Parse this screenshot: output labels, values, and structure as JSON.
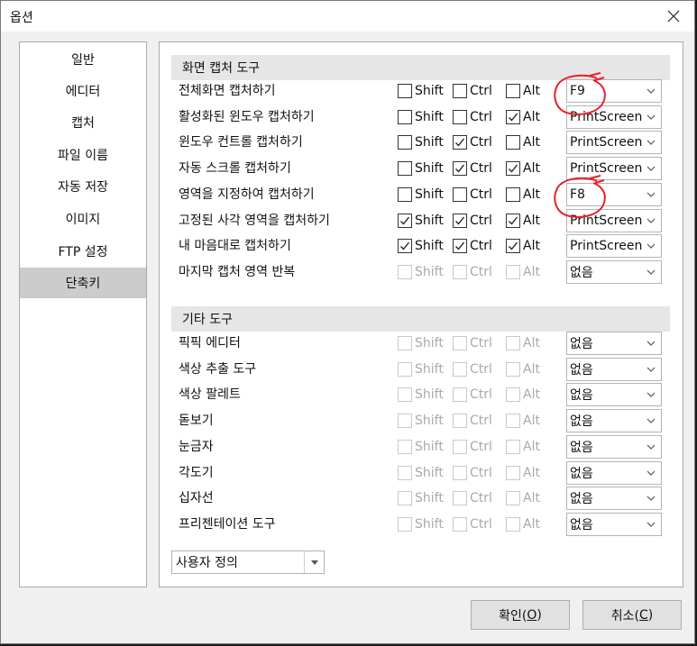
{
  "window": {
    "title": "옵션"
  },
  "nav": {
    "items": [
      {
        "label": "일반"
      },
      {
        "label": "에디터"
      },
      {
        "label": "캡처"
      },
      {
        "label": "파일 이름"
      },
      {
        "label": "자동 저장"
      },
      {
        "label": "이미지"
      },
      {
        "label": "FTP 설정"
      },
      {
        "label": "단축키",
        "active": true
      }
    ]
  },
  "sections": [
    {
      "title": "화면 캡처 도구",
      "rows": [
        {
          "label": "전체화면 캡처하기",
          "shift": false,
          "ctrl": false,
          "alt": false,
          "enabled": true,
          "key": "F9"
        },
        {
          "label": "활성화된 윈도우 캡처하기",
          "shift": false,
          "ctrl": false,
          "alt": true,
          "enabled": true,
          "key": "PrintScreen"
        },
        {
          "label": "윈도우 컨트롤 캡처하기",
          "shift": false,
          "ctrl": true,
          "alt": false,
          "enabled": true,
          "key": "PrintScreen"
        },
        {
          "label": "자동 스크롤 캡처하기",
          "shift": false,
          "ctrl": true,
          "alt": true,
          "enabled": true,
          "key": "PrintScreen"
        },
        {
          "label": "영역을 지정하여 캡처하기",
          "shift": false,
          "ctrl": false,
          "alt": false,
          "enabled": true,
          "key": "F8"
        },
        {
          "label": "고정된 사각 영역을 캡처하기",
          "shift": true,
          "ctrl": true,
          "alt": true,
          "enabled": true,
          "key": "PrintScreen"
        },
        {
          "label": "내 마음대로 캡처하기",
          "shift": true,
          "ctrl": true,
          "alt": true,
          "enabled": true,
          "key": "PrintScreen"
        },
        {
          "label": "마지막 캡처 영역 반복",
          "shift": false,
          "ctrl": false,
          "alt": false,
          "enabled": false,
          "key": "없음"
        }
      ]
    },
    {
      "title": "기타 도구",
      "rows": [
        {
          "label": "픽픽 에디터",
          "shift": false,
          "ctrl": false,
          "alt": false,
          "enabled": false,
          "key": "없음"
        },
        {
          "label": "색상 추출 도구",
          "shift": false,
          "ctrl": false,
          "alt": false,
          "enabled": false,
          "key": "없음"
        },
        {
          "label": "색상 팔레트",
          "shift": false,
          "ctrl": false,
          "alt": false,
          "enabled": false,
          "key": "없음"
        },
        {
          "label": "돋보기",
          "shift": false,
          "ctrl": false,
          "alt": false,
          "enabled": false,
          "key": "없음"
        },
        {
          "label": "눈금자",
          "shift": false,
          "ctrl": false,
          "alt": false,
          "enabled": false,
          "key": "없음"
        },
        {
          "label": "각도기",
          "shift": false,
          "ctrl": false,
          "alt": false,
          "enabled": false,
          "key": "없음"
        },
        {
          "label": "십자선",
          "shift": false,
          "ctrl": false,
          "alt": false,
          "enabled": false,
          "key": "없음"
        },
        {
          "label": "프리젠테이션 도구",
          "shift": false,
          "ctrl": false,
          "alt": false,
          "enabled": false,
          "key": "없음"
        }
      ]
    }
  ],
  "modifiers": {
    "shift": "Shift",
    "ctrl": "Ctrl",
    "alt": "Alt"
  },
  "preset": {
    "value": "사용자 정의"
  },
  "buttons": {
    "ok": {
      "label": "확인(",
      "mnemonic": "O",
      "tail": ")"
    },
    "cancel": {
      "label": "취소(",
      "mnemonic": "C",
      "tail": ")"
    }
  },
  "colors": {
    "annotation": "#e8202a",
    "selected_nav": "#cccccc"
  }
}
